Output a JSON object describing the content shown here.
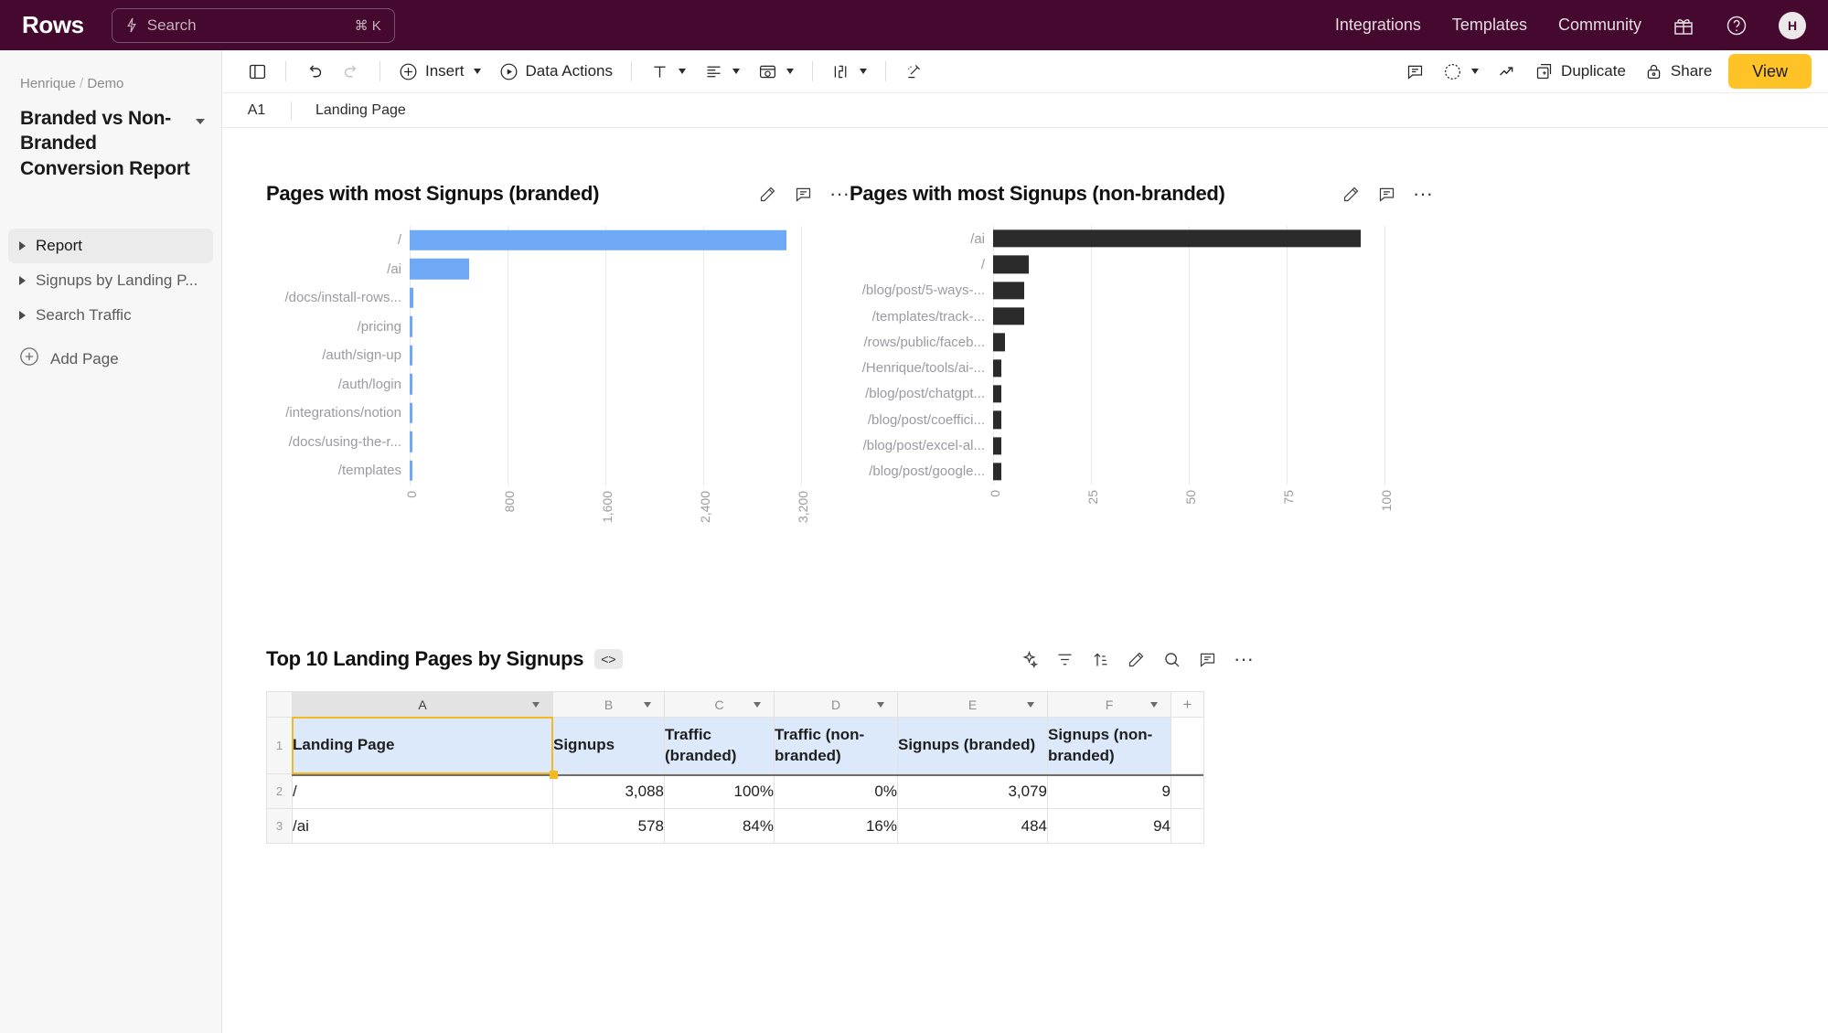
{
  "topbar": {
    "brand": "Rows",
    "search_placeholder": "Search",
    "search_shortcut": "⌘ K",
    "nav": [
      {
        "label": "Integrations"
      },
      {
        "label": "Templates"
      },
      {
        "label": "Community"
      }
    ],
    "gift_icon": "gift-icon",
    "help_icon": "help-circle-icon",
    "avatar_initial": "H"
  },
  "toolbar": {
    "panel_label": "",
    "insert_label": "Insert",
    "data_actions_label": "Data Actions",
    "duplicate_label": "Duplicate",
    "share_label": "Share",
    "view_label": "View"
  },
  "formula_bar": {
    "cell_ref": "A1",
    "value": "Landing Page"
  },
  "sidebar": {
    "breadcrumb_owner": "Henrique",
    "breadcrumb_sep": "/",
    "breadcrumb_workspace": "Demo",
    "doc_title": "Branded vs Non-Branded Conversion Report",
    "pages": [
      {
        "label": "Report",
        "active": true
      },
      {
        "label": "Signups by Landing P...",
        "active": false
      },
      {
        "label": "Search Traffic",
        "active": false
      }
    ],
    "add_page_label": "Add Page"
  },
  "chart_data": [
    {
      "type": "bar",
      "orientation": "horizontal",
      "title": "Pages with most Signups (branded)",
      "xlabel": "",
      "ylabel": "",
      "categories": [
        "/",
        "/ai",
        "/docs/install-rows...",
        "/pricing",
        "/auth/sign-up",
        "/auth/login",
        "/integrations/notion",
        "/docs/using-the-r...",
        "/templates"
      ],
      "values": [
        3079,
        484,
        29,
        16,
        15,
        5,
        3,
        3,
        2
      ],
      "xticks": [
        "0",
        "800",
        "1,600",
        "2,400",
        "3,200"
      ],
      "xlim": [
        0,
        3200
      ],
      "grid": true,
      "color": "#6fa8f5"
    },
    {
      "type": "bar",
      "orientation": "horizontal",
      "title": "Pages with most Signups (non-branded)",
      "xlabel": "",
      "ylabel": "",
      "categories": [
        "/ai",
        "/",
        "/blog/post/5-ways-...",
        "/templates/track-...",
        "/rows/public/faceb...",
        "/Henrique/tools/ai-...",
        "/blog/post/chatgpt...",
        "/blog/post/coeffici...",
        "/blog/post/excel-al...",
        "/blog/post/google..."
      ],
      "values": [
        94,
        9,
        8,
        8,
        3,
        2,
        2,
        2,
        2,
        2
      ],
      "xticks": [
        "0",
        "25",
        "50",
        "75",
        "100"
      ],
      "xlim": [
        0,
        100
      ],
      "grid": true,
      "color": "#2b2b2b"
    }
  ],
  "chart_left": {
    "title": "Pages with most Signups (branded)",
    "edit_icon": "pencil-icon",
    "comment_icon": "comment-icon",
    "more_icon": "more-horizontal-icon"
  },
  "chart_right": {
    "title": "Pages with most Signups (non-branded)",
    "edit_icon": "pencil-icon",
    "comment_icon": "comment-icon",
    "more_icon": "more-horizontal-icon"
  },
  "table_widget": {
    "title": "Top 10 Landing Pages by Signups",
    "code_badge": "<>",
    "actions": [
      "sparkle-icon",
      "filter-icon",
      "sort-icon",
      "pencil-icon",
      "search-icon",
      "comment-icon",
      "more-horizontal-icon"
    ],
    "column_letters": [
      "A",
      "B",
      "C",
      "D",
      "E",
      "F"
    ],
    "add_column": "+",
    "row_numbers": [
      "1",
      "2",
      "3"
    ],
    "headers": [
      "Landing Page",
      "Signups",
      "Traffic (branded)",
      "Traffic (non-branded)",
      "Signups (branded)",
      "Signups (non-branded)"
    ],
    "rows": [
      [
        "/",
        "3,088",
        "100%",
        "0%",
        "3,079",
        "9"
      ],
      [
        "/ai",
        "578",
        "84%",
        "16%",
        "484",
        "94"
      ]
    ]
  },
  "colors": {
    "brand_purple": "#45082f",
    "accent_yellow": "#ffc328",
    "bar_blue": "#6fa8f5",
    "bar_dark": "#2b2b2b",
    "selection": "#f5b820"
  }
}
